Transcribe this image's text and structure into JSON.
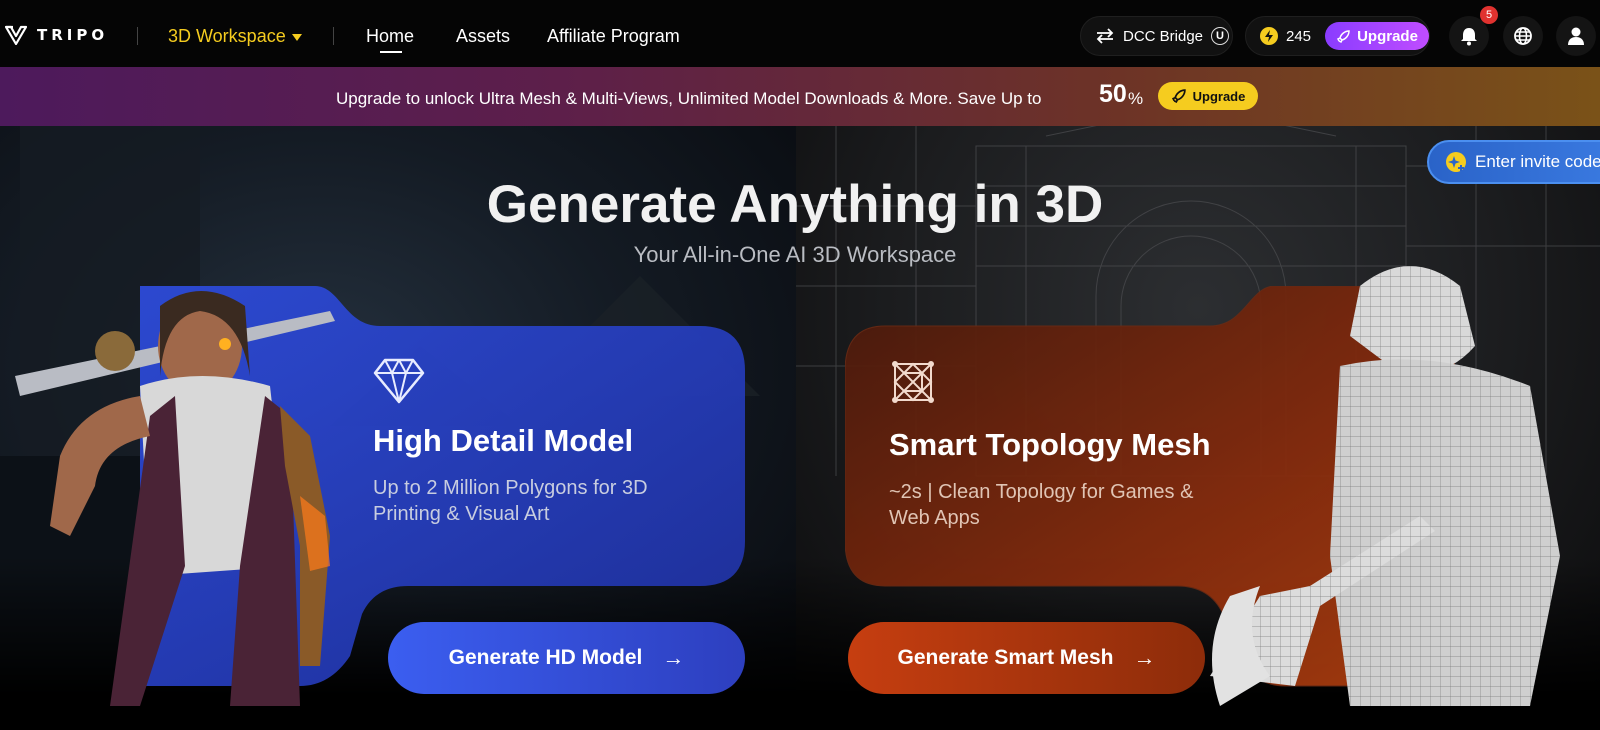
{
  "topbar": {
    "logo_text": "TRIPO",
    "workspace_label": "3D Workspace",
    "nav": [
      {
        "label": "Home",
        "active": true
      },
      {
        "label": "Assets",
        "active": false
      },
      {
        "label": "Affiliate Program",
        "active": false
      }
    ],
    "dcc_bridge_label": "DCC Bridge",
    "dcc_badge": "U",
    "credits": "245",
    "upgrade_label": "Upgrade",
    "notification_count": "5"
  },
  "promo": {
    "text": "Upgrade to unlock Ultra Mesh & Multi-Views, Unlimited Model Downloads & More. Save Up to",
    "highlight": "50",
    "suffix": "%",
    "button_label": "Upgrade"
  },
  "hero": {
    "title": "Generate Anything in 3D",
    "subtitle": "Your All-in-One AI 3D Workspace",
    "invite_label": "Enter invite code"
  },
  "cards": {
    "hd": {
      "title": "High Detail Model",
      "description": "Up to 2 Million Polygons for 3D Printing & Visual Art",
      "button_label": "Generate HD Model",
      "icon": "diamond-icon"
    },
    "smart": {
      "title": "Smart Topology Mesh",
      "description": "~2s | Clean Topology for Games & Web Apps",
      "button_label": "Generate Smart Mesh",
      "icon": "mesh-icon"
    }
  },
  "colors": {
    "accent_yellow": "#f5cc1f",
    "upgrade_purple": "#8a3cff",
    "card_blue": "#2c47d6",
    "card_orange": "#9a3310",
    "badge_red": "#e0322f"
  }
}
